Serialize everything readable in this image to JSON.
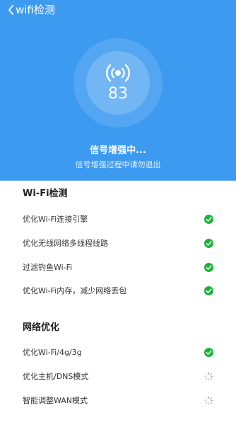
{
  "header": {
    "title": "wifi检测"
  },
  "progress": {
    "value": "83"
  },
  "status": {
    "title": "信号增强中...",
    "subtitle": "信号增强过程中请勿退出"
  },
  "sections": [
    {
      "title": "Wi-Fi检测",
      "items": [
        {
          "label": "优化Wi-Fi连接引擎",
          "state": "done"
        },
        {
          "label": "优化无线网络多线程线路",
          "state": "done"
        },
        {
          "label": "过滤钓鱼Wi-Fi",
          "state": "done"
        },
        {
          "label": "优化Wi-Fi内存，减少网络丢包",
          "state": "done"
        }
      ]
    },
    {
      "title": "网络优化",
      "items": [
        {
          "label": "优化Wi-Fi/4g/3g",
          "state": "done"
        },
        {
          "label": "优化主机/DNS模式",
          "state": "loading"
        },
        {
          "label": "智能调整WAN模式",
          "state": "loading"
        }
      ]
    }
  ],
  "colors": {
    "accent": "#3d9af1",
    "success": "#1bb53a",
    "spinner": "#9a9a9a"
  },
  "icons": {
    "back": "chevron-left-icon",
    "signal": "wifi-signal-icon",
    "done": "check-circle-icon",
    "loading": "spinner-icon"
  }
}
